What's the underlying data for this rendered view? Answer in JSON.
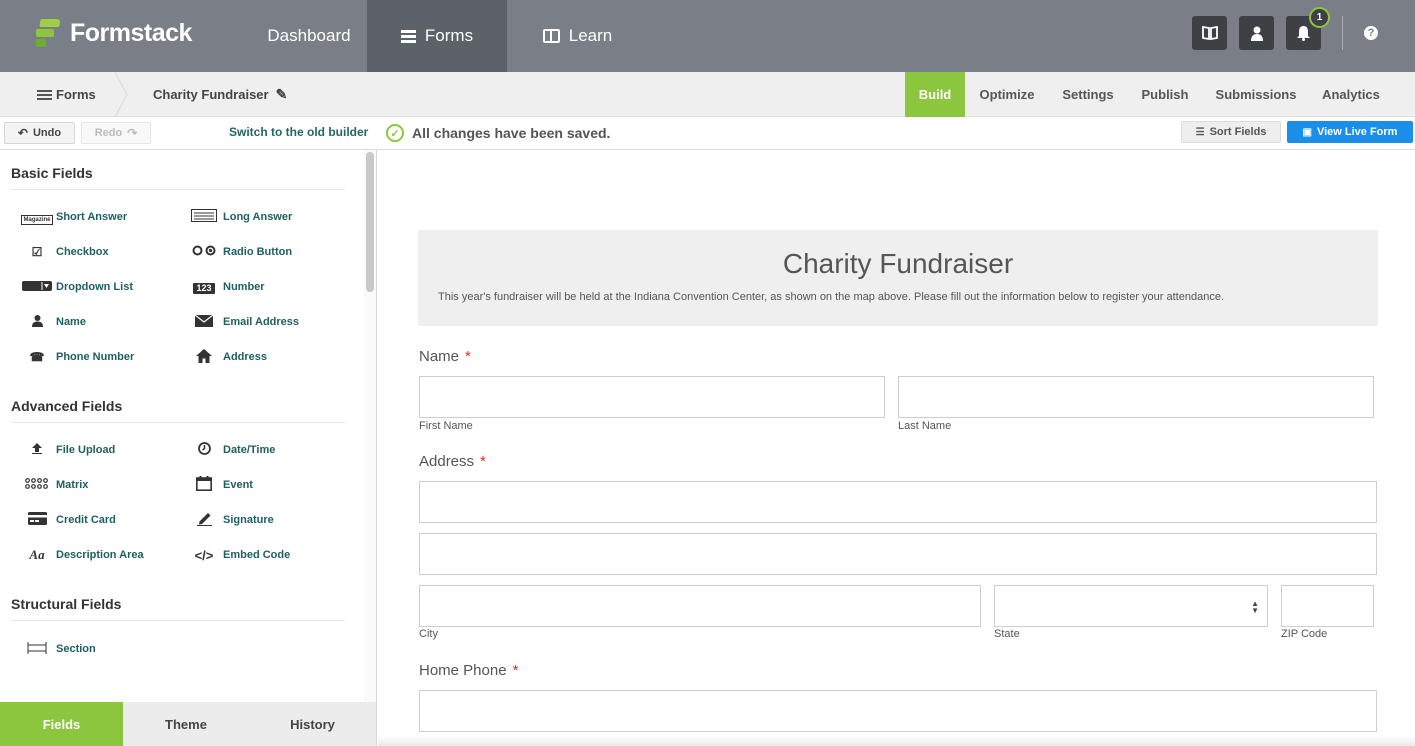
{
  "brand": {
    "name": "Formstack"
  },
  "nav": {
    "dashboard": "Dashboard",
    "forms": "Forms",
    "learn": "Learn"
  },
  "notifications": {
    "count": "1"
  },
  "help": "?",
  "breadcrumb": {
    "forms": "Forms",
    "form_name": "Charity Fundraiser"
  },
  "tabs": {
    "build": "Build",
    "optimize": "Optimize",
    "settings": "Settings",
    "publish": "Publish",
    "submissions": "Submissions",
    "analytics": "Analytics"
  },
  "toolbar": {
    "undo": "Undo",
    "redo": "Redo",
    "old_builder": "Switch to the old builder",
    "save_status": "All changes have been saved.",
    "sort_fields": "Sort Fields",
    "view_live": "View Live Form"
  },
  "sidebar": {
    "basic_title": "Basic Fields",
    "basic": [
      {
        "label": "Short Answer",
        "icon": "short-answer-icon"
      },
      {
        "label": "Long Answer",
        "icon": "long-answer-icon"
      },
      {
        "label": "Checkbox",
        "icon": "checkbox-icon"
      },
      {
        "label": "Radio Button",
        "icon": "radio-button-icon"
      },
      {
        "label": "Dropdown List",
        "icon": "dropdown-icon"
      },
      {
        "label": "Number",
        "icon": "number-icon"
      },
      {
        "label": "Name",
        "icon": "person-icon"
      },
      {
        "label": "Email Address",
        "icon": "envelope-icon"
      },
      {
        "label": "Phone Number",
        "icon": "phone-icon"
      },
      {
        "label": "Address",
        "icon": "house-icon"
      }
    ],
    "advanced_title": "Advanced Fields",
    "advanced": [
      {
        "label": "File Upload",
        "icon": "upload-icon"
      },
      {
        "label": "Date/Time",
        "icon": "clock-icon"
      },
      {
        "label": "Matrix",
        "icon": "matrix-icon"
      },
      {
        "label": "Event",
        "icon": "calendar-icon"
      },
      {
        "label": "Credit Card",
        "icon": "credit-card-icon"
      },
      {
        "label": "Signature",
        "icon": "pen-icon"
      },
      {
        "label": "Description Area",
        "icon": "text-icon"
      },
      {
        "label": "Embed Code",
        "icon": "code-icon"
      }
    ],
    "structural_title": "Structural Fields",
    "structural": [
      {
        "label": "Section",
        "icon": "section-icon"
      }
    ],
    "icon_text": {
      "short_answer": "Magazine",
      "number": "123",
      "description": "Aa",
      "embed": "</>"
    },
    "tabs": {
      "fields": "Fields",
      "theme": "Theme",
      "history": "History"
    }
  },
  "form": {
    "title": "Charity Fundraiser",
    "description": "This year's fundraiser will be held at the Indiana Convention Center, as shown on the map above. Please fill out the information below to register your attendance.",
    "name_label": "Name",
    "first_name": "First Name",
    "last_name": "Last Name",
    "address_label": "Address",
    "city": "City",
    "state": "State",
    "zip": "ZIP Code",
    "home_phone_label": "Home Phone",
    "required_mark": "*"
  },
  "colors": {
    "accent_green": "#8cc63f",
    "topbar": "#7a7f87",
    "primary_blue": "#1a8ee8",
    "field_link": "#1f5f60",
    "required": "#e02b27"
  }
}
